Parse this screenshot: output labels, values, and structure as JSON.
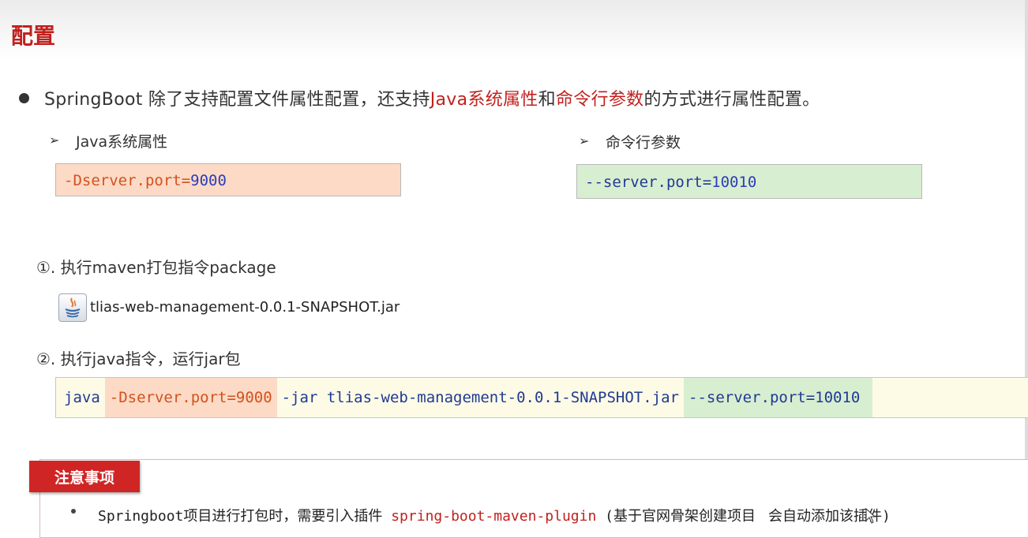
{
  "title": "配置",
  "intro": {
    "part1": "SpringBoot 除了支持配置文件属性配置，还支持",
    "hl1": "Java系统属性",
    "part2": "和",
    "hl2": "命令行参数",
    "part3": "的方式进行属性配置。"
  },
  "java_props": {
    "arrow": "➢",
    "label": "Java系统属性",
    "code_key": "-Dserver.port=",
    "code_val": "9000"
  },
  "cmd_args": {
    "arrow": "➢",
    "label": "命令行参数",
    "code_key": "--server.port=",
    "code_val": "10010"
  },
  "step1": {
    "label": "①. 执行maven打包指令package",
    "jar_icon": "java-jar-icon",
    "jar_name": "tlias-web-management-0.0.1-SNAPSHOT.jar"
  },
  "step2": {
    "label": "②. 执行java指令，运行jar包",
    "cmd_java": "java",
    "cmd_d": "-Dserver.port=9000",
    "cmd_jar": "-jar tlias-web-management-0.0.1-SNAPSHOT.jar",
    "cmd_server": "--server.port=10010"
  },
  "notice": {
    "tag": "注意事项",
    "text_pre": "Springboot项目进行打包时，需要引入插件 ",
    "plugin": "spring-boot-maven-plugin",
    "text_mid": " (基于官网骨架创建项目",
    "text_post": "会自动添加该插件)"
  },
  "colors": {
    "accent_red": "#c0211e",
    "orange_bg": "#fcdac6",
    "green_bg": "#d8eed0",
    "cmd_bg": "#fdfbe6"
  }
}
